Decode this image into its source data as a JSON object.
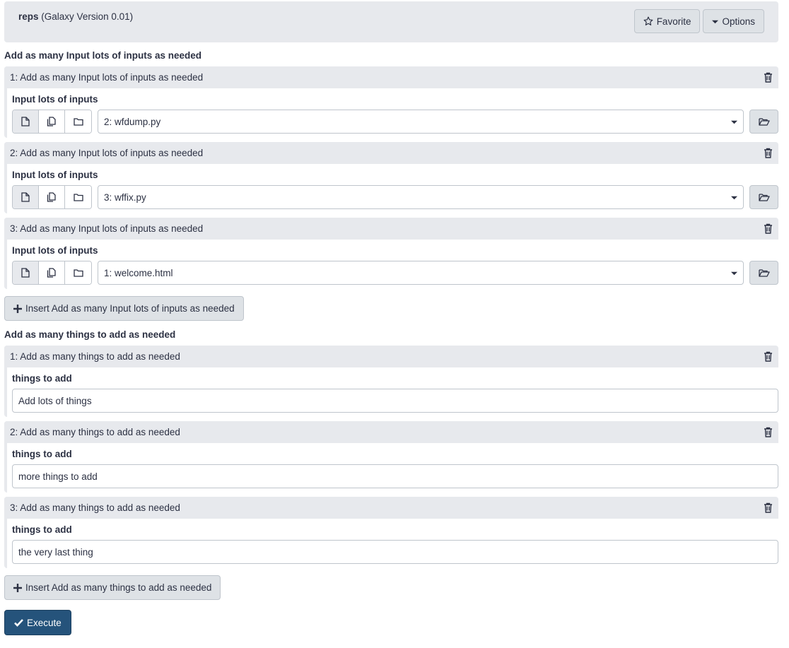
{
  "tool": {
    "name": "reps",
    "version": "(Galaxy Version 0.01)",
    "favorite_label": "Favorite",
    "options_label": "Options"
  },
  "inputs_section": {
    "title": "Add as many Input lots of inputs as needed",
    "items": [
      {
        "header": "1: Add as many Input lots of inputs as needed",
        "label": "Input lots of inputs",
        "value": "2: wfdump.py"
      },
      {
        "header": "2: Add as many Input lots of inputs as needed",
        "label": "Input lots of inputs",
        "value": "3: wffix.py"
      },
      {
        "header": "3: Add as many Input lots of inputs as needed",
        "label": "Input lots of inputs",
        "value": "1: welcome.html"
      }
    ],
    "insert_label": "Insert Add as many Input lots of inputs as needed"
  },
  "things_section": {
    "title": "Add as many things to add as needed",
    "items": [
      {
        "header": "1: Add as many things to add as needed",
        "label": "things to add",
        "value": "Add lots of things"
      },
      {
        "header": "2: Add as many things to add as needed",
        "label": "things to add",
        "value": "more things to add"
      },
      {
        "header": "3: Add as many things to add as needed",
        "label": "things to add",
        "value": "the very last thing"
      }
    ],
    "insert_label": "Insert Add as many things to add as needed"
  },
  "execute_label": "Execute",
  "colors": {
    "primary": "#25537b",
    "panel": "#e7e9ed",
    "button": "#dee2e6"
  }
}
